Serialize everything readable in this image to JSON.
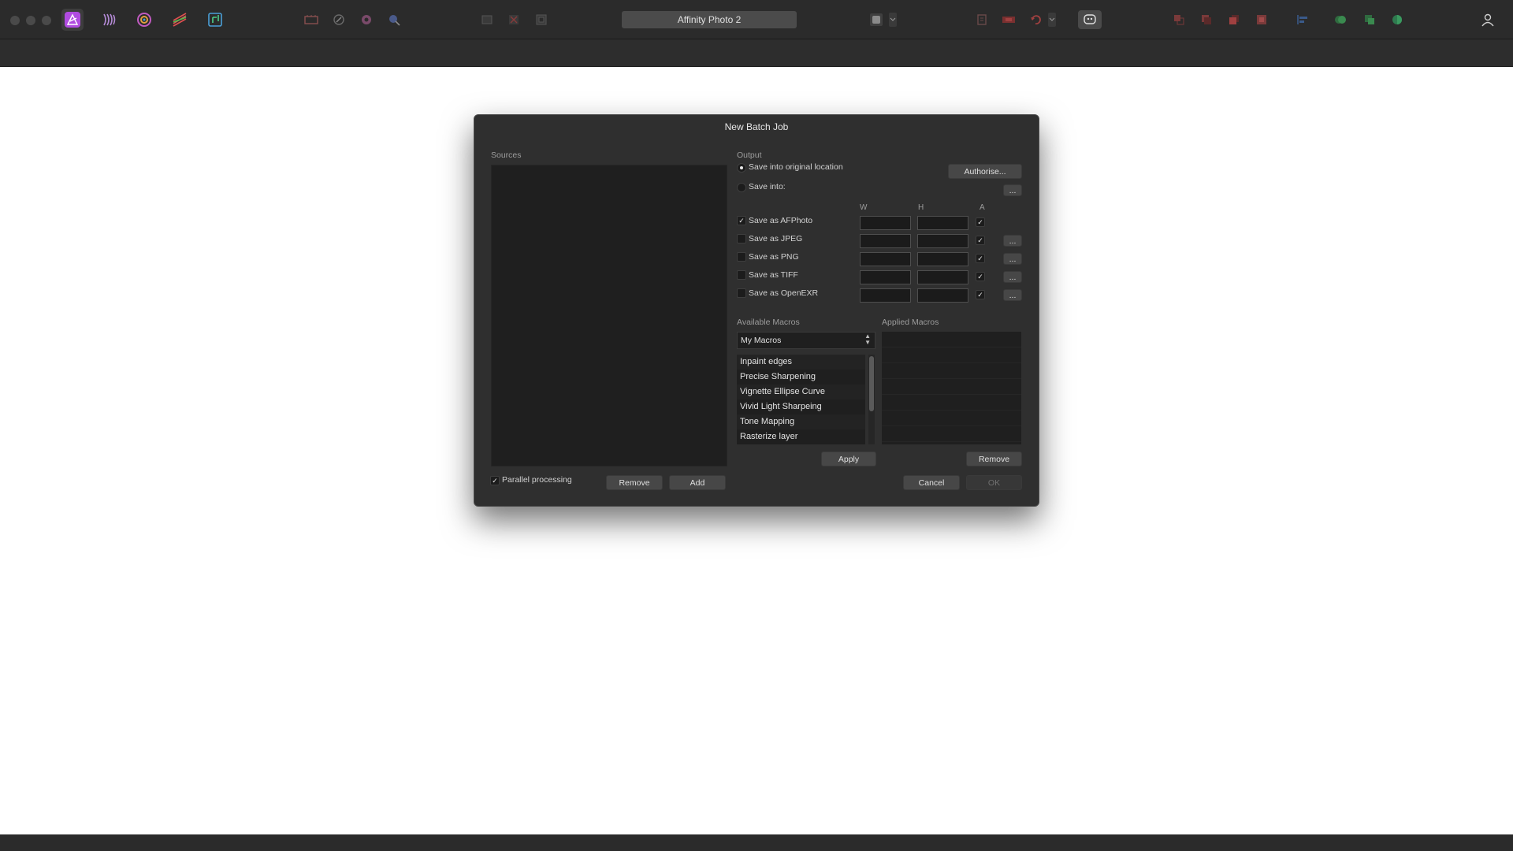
{
  "app": {
    "document_title": "Affinity Photo 2"
  },
  "toolbar": {
    "personas": [
      "photo-persona-icon",
      "liquify-persona-icon",
      "develop-persona-icon",
      "tone-mapping-persona-icon",
      "export-persona-icon"
    ],
    "accent_color": "#b04be0"
  },
  "dialog": {
    "title": "New Batch Job",
    "sources_label": "Sources",
    "parallel_processing_label": "Parallel processing",
    "parallel_processing_checked": true,
    "remove_label": "Remove",
    "add_label": "Add",
    "output": {
      "label": "Output",
      "save_original_label": "Save into original location",
      "save_into_label": "Save into:",
      "authorise_label": "Authorise...",
      "browse_label": "...",
      "col_w": "W",
      "col_h": "H",
      "col_a": "A",
      "formats": [
        {
          "label": "Save as AFPhoto",
          "checked": true,
          "w": "",
          "h": "",
          "a": true
        },
        {
          "label": "Save as JPEG",
          "checked": false,
          "w": "",
          "h": "",
          "a": true
        },
        {
          "label": "Save as PNG",
          "checked": false,
          "w": "",
          "h": "",
          "a": true
        },
        {
          "label": "Save as TIFF",
          "checked": false,
          "w": "",
          "h": "",
          "a": true
        },
        {
          "label": "Save as OpenEXR",
          "checked": false,
          "w": "",
          "h": "",
          "a": true
        }
      ]
    },
    "macros": {
      "available_label": "Available Macros",
      "applied_label": "Applied Macros",
      "category": "My Macros",
      "items": [
        "Inpaint edges",
        "Precise Sharpening",
        "Vignette Ellipse Curve",
        "Vivid Light Sharpeing",
        "Tone Mapping",
        "Rasterize layer"
      ],
      "apply_label": "Apply",
      "remove_label": "Remove"
    },
    "cancel_label": "Cancel",
    "ok_label": "OK"
  }
}
